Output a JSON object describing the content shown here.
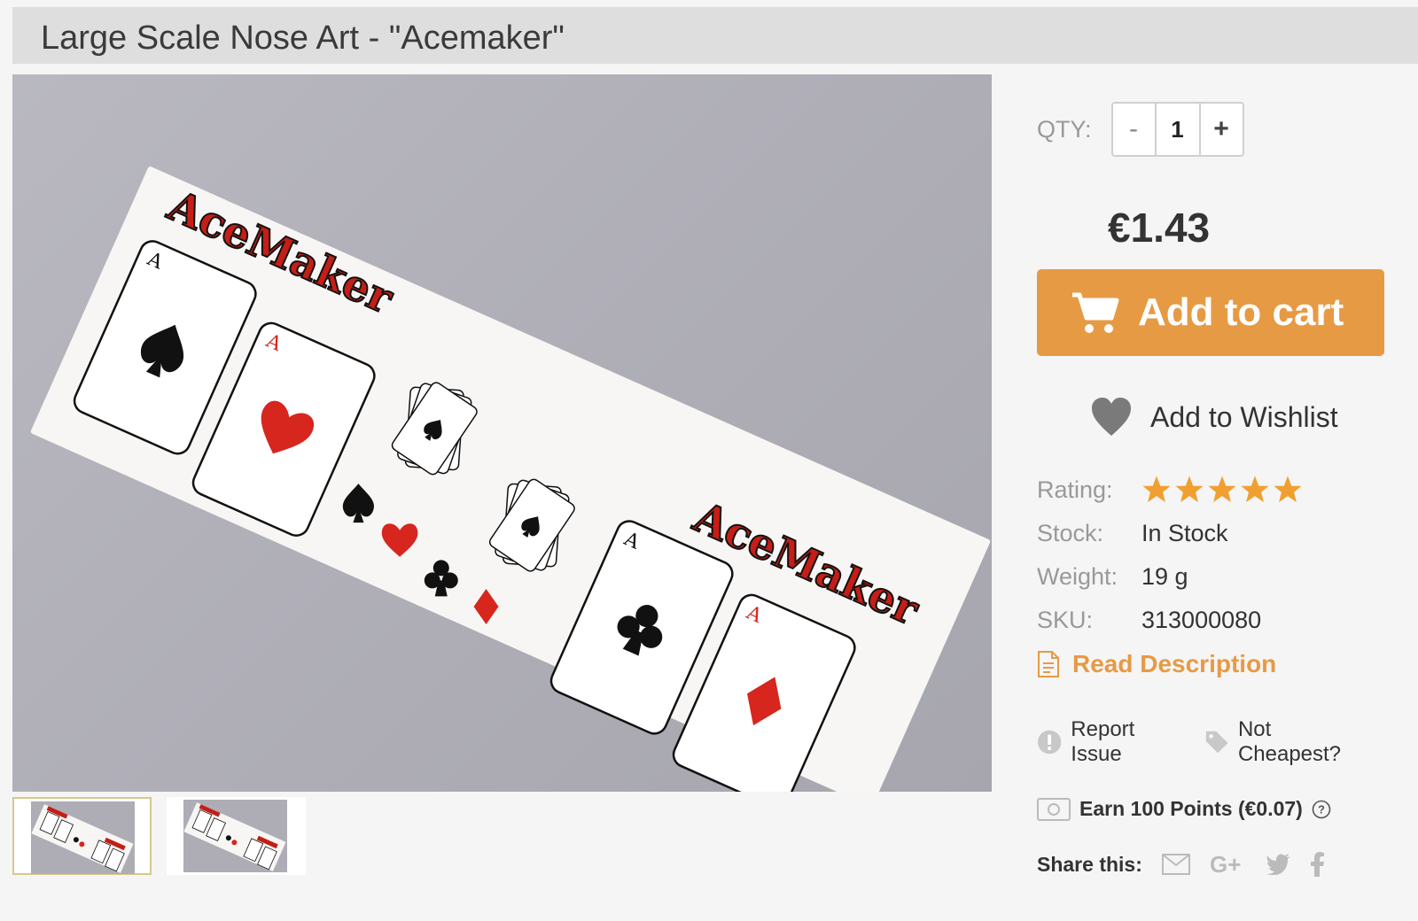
{
  "product": {
    "title": "Large Scale Nose Art - \"Acemaker\"",
    "main_image_alt": "AceMaker nose art decal sheet",
    "decal_logo_text": "AceMaker"
  },
  "thumbnails": [
    {
      "alt": "AceMaker decal sheet thumbnail 1",
      "active": true
    },
    {
      "alt": "AceMaker decal sheet thumbnail 2",
      "active": false
    }
  ],
  "purchase": {
    "qty_label": "QTY:",
    "qty_minus": "-",
    "qty_value": "1",
    "qty_plus": "+",
    "price": "€1.43",
    "add_to_cart": "Add to cart",
    "add_to_wishlist": "Add to Wishlist"
  },
  "specs": {
    "rating_label": "Rating:",
    "rating_value": 5,
    "rating_max": 5,
    "stock_label": "Stock:",
    "stock_value": "In Stock",
    "weight_label": "Weight:",
    "weight_value": "19 g",
    "sku_label": "SKU:",
    "sku_value": "313000080"
  },
  "links": {
    "read_description": "Read Description",
    "report_issue": "Report Issue",
    "not_cheapest": "Not Cheapest?"
  },
  "points": {
    "earn_text": "Earn 100 Points (€0.07)"
  },
  "share": {
    "label": "Share this:",
    "icons": [
      "email-icon",
      "google-plus-icon",
      "twitter-icon",
      "facebook-icon"
    ]
  },
  "colors": {
    "accent": "#e79a44",
    "star": "#f0a030",
    "title_bar": "#dedede",
    "text_muted": "#999999"
  }
}
